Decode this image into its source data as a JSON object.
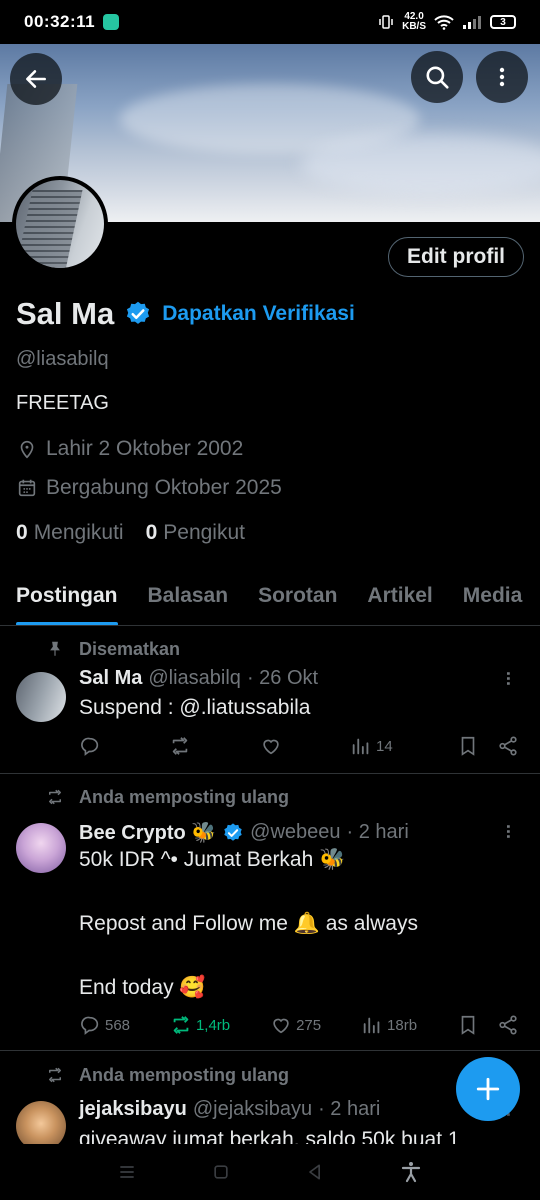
{
  "status_bar": {
    "time": "00:32:11",
    "net_speed_value": "42.0",
    "net_speed_unit": "KB/S",
    "battery": "3"
  },
  "profile": {
    "name": "Sal Ma",
    "verify_link": "Dapatkan Verifikasi",
    "handle": "@liasabilq",
    "bio": "FREETAG",
    "birthday": "Lahir 2 Oktober 2002",
    "joined": "Bergabung Oktober 2025",
    "following_count": "0",
    "following_label": "Mengikuti",
    "followers_count": "0",
    "followers_label": "Pengikut",
    "edit_button": "Edit profil"
  },
  "tabs": [
    {
      "label": "Postingan",
      "active": true
    },
    {
      "label": "Balasan",
      "active": false
    },
    {
      "label": "Sorotan",
      "active": false
    },
    {
      "label": "Artikel",
      "active": false
    },
    {
      "label": "Media",
      "active": false
    }
  ],
  "posts": [
    {
      "context": "Disematkan",
      "name": "Sal Ma",
      "handle": "@liasabilq",
      "time": "· 26 Okt",
      "text": "Suspend : @.liatussabila",
      "replies": "",
      "reposts": "",
      "likes": "",
      "views": "14"
    },
    {
      "context": "Anda memposting ulang",
      "name": "Bee Crypto 🐝",
      "handle": "@webeeu",
      "time": "· 2 hari",
      "text": "50k IDR ^• Jumat Berkah 🐝\n\nRepost and Follow me 🔔 as always\n\nEnd today 🥰",
      "replies": "568",
      "reposts": "1,4rb",
      "likes": "275",
      "views": "18rb"
    },
    {
      "context": "Anda memposting ulang",
      "name": "jejaksibayu",
      "handle": "@jejaksibayu",
      "time": "· 2 hari",
      "text": "giveaway jumat berkah, saldo 50k buat 1"
    }
  ],
  "colors": {
    "accent": "#1d9bf0",
    "background": "#000000",
    "muted": "#71767b",
    "repost_green": "#00ba7c"
  }
}
